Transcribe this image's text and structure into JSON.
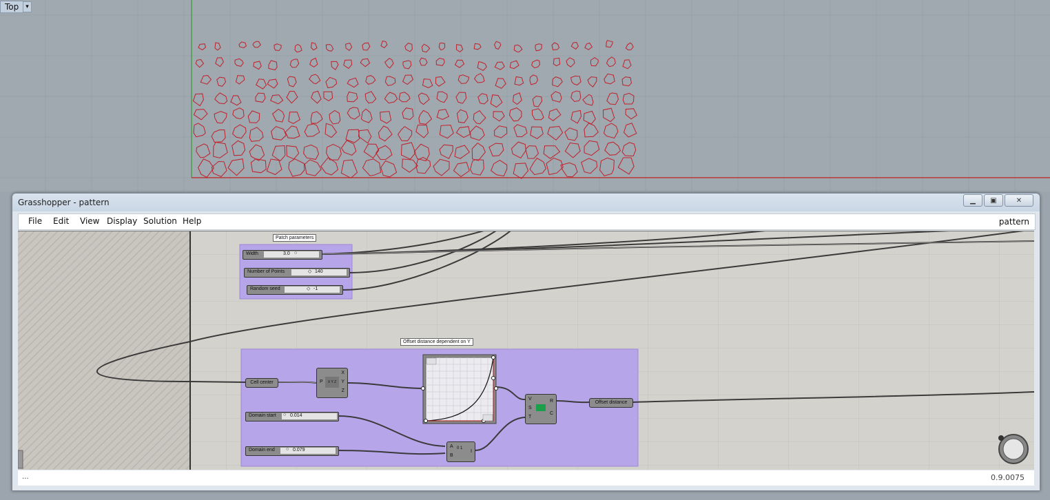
{
  "viewport": {
    "label": "Top",
    "dropdown_icon": "triangle-down-icon"
  },
  "window": {
    "title": "Grasshopper - pattern",
    "minimize_icon": "minimize-icon",
    "maximize_icon": "maximize-icon",
    "close_icon": "close-icon"
  },
  "menu": {
    "items": [
      "File",
      "Edit",
      "View",
      "Display",
      "Solution",
      "Help"
    ],
    "document_name": "pattern"
  },
  "groups": {
    "patch": {
      "title": "Patch parameters"
    },
    "offset": {
      "title": "Offset distance dependent on Y"
    }
  },
  "sliders": {
    "width": {
      "name": "Width",
      "value": "3.0"
    },
    "points": {
      "name": "Number of Points",
      "value": "140"
    },
    "seed": {
      "name": "Random seed",
      "value": "-1"
    },
    "domain_start": {
      "name": "Domain start",
      "value": "0.014"
    },
    "domain_end": {
      "name": "Domain end",
      "value": "0.079"
    }
  },
  "components": {
    "cell_center": {
      "name": "Cell center"
    },
    "deconstruct": {
      "inputs": [
        "P"
      ],
      "outputs": [
        "X",
        "Y",
        "Z"
      ],
      "glyph": "X Y Z"
    },
    "graph_mapper": {
      "name": "graph"
    },
    "remap": {
      "inputs": [
        "V",
        "S",
        "T"
      ],
      "outputs": [
        "R",
        "C"
      ]
    },
    "construct_domain": {
      "inputs": [
        "A",
        "B"
      ],
      "outputs": [
        "I"
      ],
      "glyph": "0 1"
    },
    "offset_distance": {
      "name": "Offset distance"
    }
  },
  "status": {
    "left": "...",
    "right": "0.9.0075"
  },
  "colors": {
    "group_fill": "#b8a6e8",
    "cell_outline": "#c0202a",
    "axis_green": "#2ea02e",
    "axis_red": "#c02020"
  }
}
